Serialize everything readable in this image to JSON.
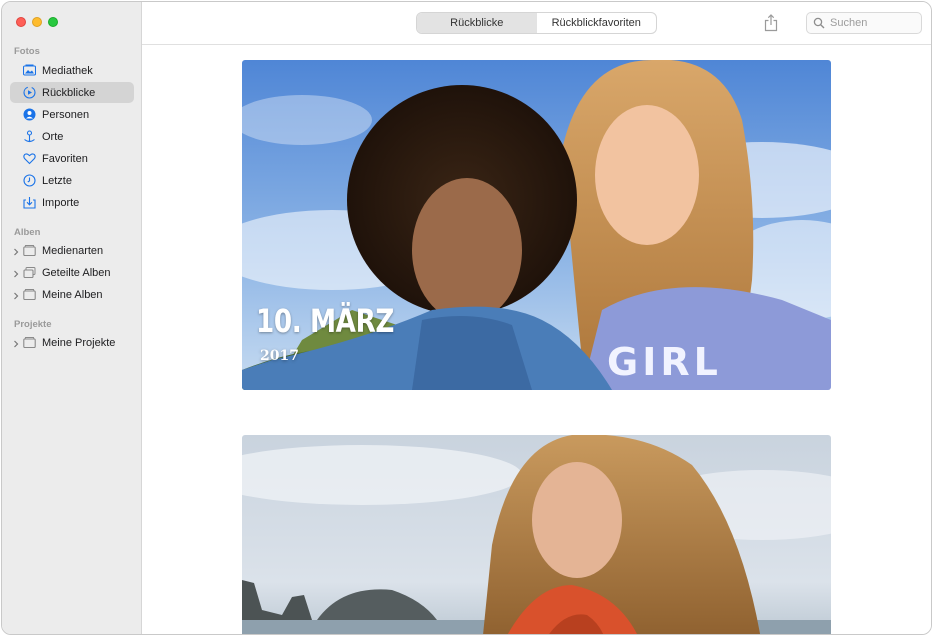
{
  "window": {
    "traffic_lights": {
      "close": "#fe5f57",
      "minimize": "#febc2e",
      "maximize": "#28c840"
    }
  },
  "sidebar": {
    "sections": [
      {
        "title": "Fotos"
      },
      {
        "title": "Alben"
      },
      {
        "title": "Projekte"
      }
    ],
    "items": [
      {
        "label": "Mediathek",
        "icon": "photo-library-icon",
        "selected": false
      },
      {
        "label": "Rückblicke",
        "icon": "memories-icon",
        "selected": true
      },
      {
        "label": "Personen",
        "icon": "person-icon",
        "selected": false
      },
      {
        "label": "Orte",
        "icon": "pin-icon",
        "selected": false
      },
      {
        "label": "Favoriten",
        "icon": "heart-icon",
        "selected": false
      },
      {
        "label": "Letzte",
        "icon": "clock-icon",
        "selected": false
      },
      {
        "label": "Importe",
        "icon": "import-icon",
        "selected": false
      },
      {
        "label": "Medienarten",
        "icon": "folder-icon",
        "selected": false
      },
      {
        "label": "Geteilte Alben",
        "icon": "shared-albums-icon",
        "selected": false
      },
      {
        "label": "Meine Alben",
        "icon": "folder-icon",
        "selected": false
      },
      {
        "label": "Meine Projekte",
        "icon": "folder-icon",
        "selected": false
      }
    ],
    "accent": "#1a73e8"
  },
  "toolbar": {
    "tabs": [
      {
        "label": "Rückblicke",
        "active": true
      },
      {
        "label": "Rückblickfavoriten",
        "active": false
      }
    ],
    "share_icon": "share-icon",
    "search": {
      "placeholder": "Suchen",
      "value": ""
    }
  },
  "memories": [
    {
      "title": "10. MÄRZ",
      "year": "2017"
    },
    {
      "title": "",
      "year": ""
    }
  ]
}
